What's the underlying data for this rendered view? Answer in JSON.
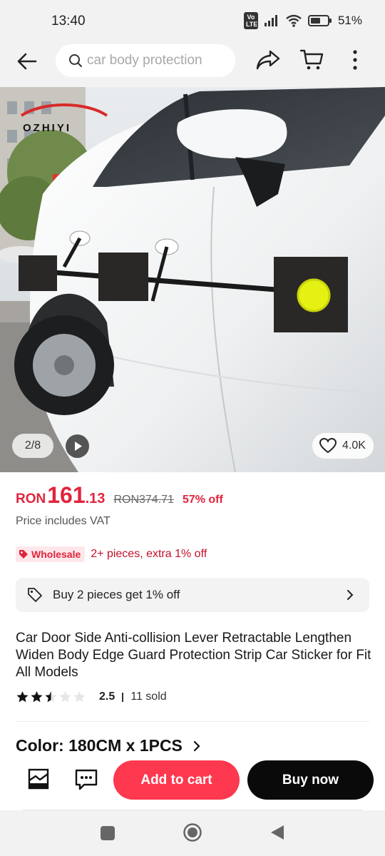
{
  "status_bar": {
    "time": "13:40",
    "volte": "Vo LTE",
    "battery_pct": "51%",
    "icons": [
      "signal-icon",
      "wifi-icon",
      "battery-icon"
    ]
  },
  "top_nav": {
    "search_placeholder": "car body protection",
    "icons": [
      "back-arrow-icon",
      "search-icon",
      "share-icon",
      "cart-icon",
      "more-vertical-icon"
    ]
  },
  "hero": {
    "brand_logo_text": "OZHIYI",
    "image_counter": "2/8",
    "wishlist_count": "4.0K"
  },
  "price": {
    "currency": "RON",
    "integer": "161",
    "decimal": ".13",
    "original": "RON374.71",
    "discount": "57% off",
    "vat_note": "Price includes VAT"
  },
  "wholesale": {
    "badge": "Wholesale",
    "text": "2+ pieces, extra 1% off"
  },
  "promo": {
    "text": "Buy 2 pieces get 1% off"
  },
  "product": {
    "title": "Car Door Side Anti-collision Lever Retractable Lengthen Widen Body Edge Guard Protection Strip Car Sticker for Fit All Models",
    "rating": "2.5",
    "rating_value": 2.5,
    "rating_max": 5,
    "sold": "11 sold"
  },
  "variant": {
    "color_label": "Color: 180CM x 1PCS"
  },
  "actions": {
    "add_to_cart": "Add to cart",
    "buy_now": "Buy now"
  },
  "colors": {
    "accent_red": "#fd384f",
    "price_red": "#e1243e",
    "buy_black": "#0a0a0a"
  }
}
